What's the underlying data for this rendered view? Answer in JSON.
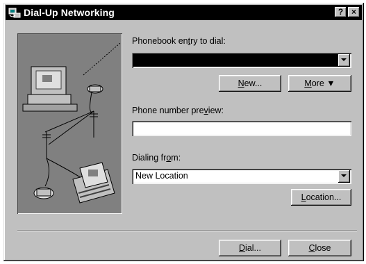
{
  "window": {
    "title": "Dial-Up Networking",
    "help_label": "?",
    "close_label": "×"
  },
  "phonebook": {
    "label_pre": "Phonebook en",
    "label_key": "t",
    "label_post": "ry to dial:",
    "value": ""
  },
  "buttons": {
    "new_key": "N",
    "new_rest": "ew...",
    "more_key": "M",
    "more_rest": "ore",
    "location_key": "L",
    "location_rest": "ocation...",
    "dial_key": "D",
    "dial_rest": "ial...",
    "close_key": "C",
    "close_rest": "lose"
  },
  "preview": {
    "label_pre": "Phone number pre",
    "label_key": "v",
    "label_post": "iew:",
    "value": ""
  },
  "dialing_from": {
    "label_pre": "Dialing fr",
    "label_key": "o",
    "label_post": "m:",
    "value": "New Location"
  }
}
